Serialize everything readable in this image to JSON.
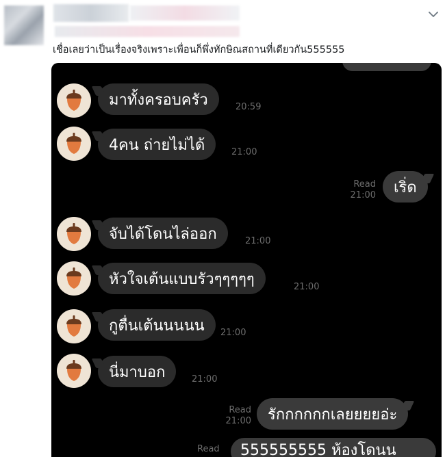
{
  "tweet": {
    "text": "เชื่อเลยว่าเป็นเรื่องจริงเพราะเพื่อนก็พึ่งทักษิณสถานที่เดียวกัน555555",
    "menu_icon": "chevron-down-icon"
  },
  "chat": {
    "avatar_icon": "acorn-icon",
    "messages": [
      {
        "text": "มาทั้งครอบครัว",
        "time": "20:59"
      },
      {
        "text": "4คน ถ่ายไม่ได้",
        "time": "21:00"
      },
      {
        "text": "เริ่ด",
        "read": "Read",
        "time": "21:00"
      },
      {
        "text": "จับได้โดนไล่ออก",
        "time": "21:00"
      },
      {
        "text": "หัวใจเต้นแบบรัวๆๆๆๆๆ",
        "time": "21:00"
      },
      {
        "text": "กูตื่นเต้นนนนน",
        "time": "21:00"
      },
      {
        "text": "นี่มาบอก",
        "time": "21:00"
      },
      {
        "text": "รักกกกกกเลยยยยอ่ะ",
        "read": "Read",
        "time": "21:00"
      },
      {
        "text": "555555555 ห้องโดนน",
        "read": "Read"
      }
    ]
  }
}
